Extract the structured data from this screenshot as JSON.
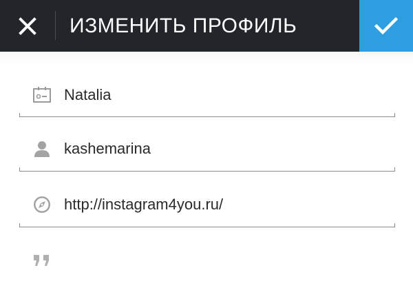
{
  "header": {
    "title": "ИЗМЕНИТЬ ПРОФИЛЬ",
    "close_icon": "close-icon",
    "confirm_icon": "checkmark-icon",
    "bar_color": "#22262b",
    "accent_color": "#2d9ee0"
  },
  "form": {
    "name_field": {
      "icon": "name-card-icon",
      "value": "Natalia"
    },
    "username_field": {
      "icon": "user-icon",
      "value": "kashemarina"
    },
    "website_field": {
      "icon": "compass-icon",
      "value": "http://instagram4you.ru/"
    },
    "bio_field": {
      "icon": "quote-icon",
      "value": ""
    }
  }
}
